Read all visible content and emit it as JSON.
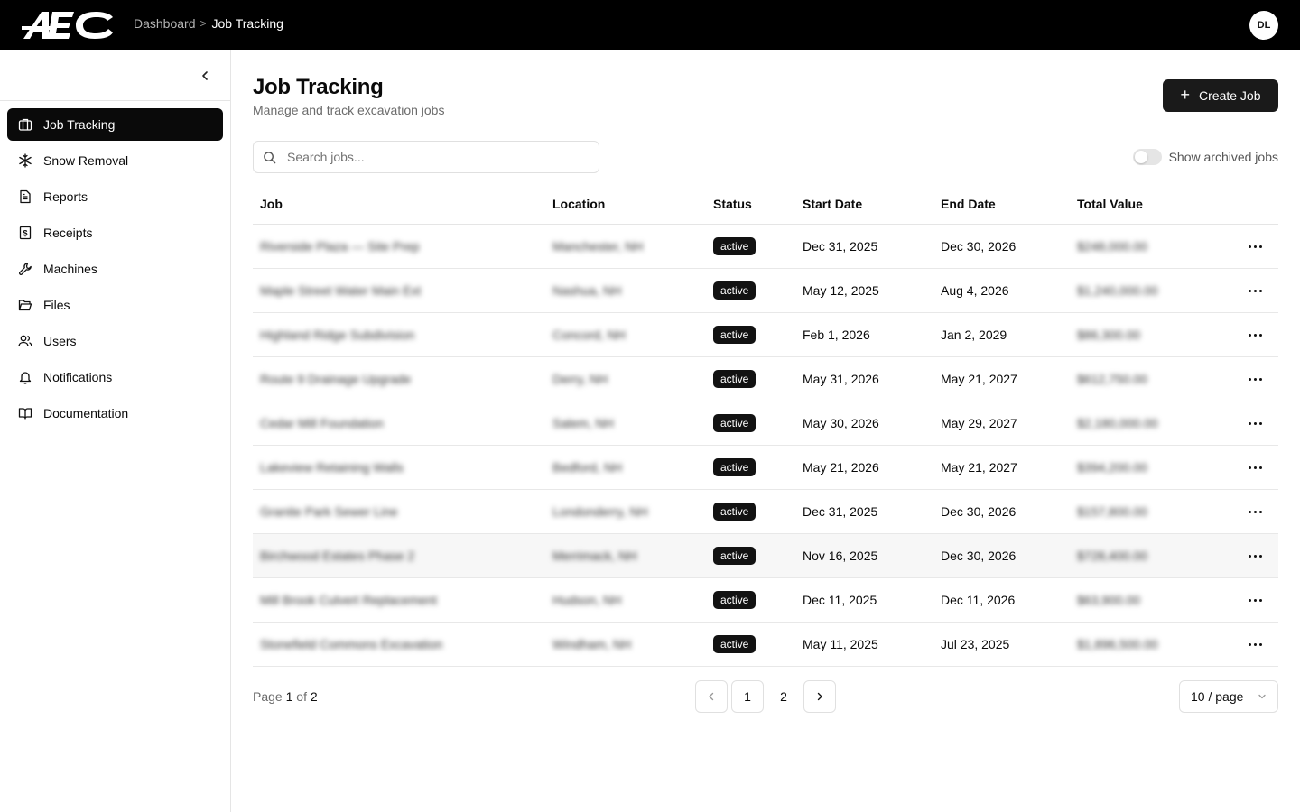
{
  "topbar": {
    "logo_text": "AEC",
    "breadcrumb": {
      "parent": "Dashboard",
      "separator": ">",
      "current": "Job Tracking"
    },
    "avatar_initials": "DL"
  },
  "sidebar": {
    "items": [
      {
        "label": "Job Tracking",
        "icon": "briefcase-icon",
        "active": true
      },
      {
        "label": "Snow Removal",
        "icon": "snowflake-icon",
        "active": false
      },
      {
        "label": "Reports",
        "icon": "document-icon",
        "active": false
      },
      {
        "label": "Receipts",
        "icon": "receipt-dollar-icon",
        "active": false
      },
      {
        "label": "Machines",
        "icon": "wrench-icon",
        "active": false
      },
      {
        "label": "Files",
        "icon": "folder-open-icon",
        "active": false
      },
      {
        "label": "Users",
        "icon": "users-icon",
        "active": false
      },
      {
        "label": "Notifications",
        "icon": "bell-icon",
        "active": false
      },
      {
        "label": "Documentation",
        "icon": "book-open-icon",
        "active": false
      }
    ]
  },
  "main": {
    "title": "Job Tracking",
    "subtitle": "Manage and track excavation jobs",
    "create_button": "Create Job",
    "search_placeholder": "Search jobs...",
    "archived_toggle_label": "Show archived jobs",
    "archived_toggle_on": false
  },
  "table": {
    "columns": [
      "Job",
      "Location",
      "Status",
      "Start Date",
      "End Date",
      "Total Value"
    ],
    "rows": [
      {
        "job": "Riverside Plaza — Site Prep",
        "location": "Manchester, NH",
        "status": "active",
        "start": "Dec 31, 2025",
        "end": "Dec 30, 2026",
        "value": "$248,000.00"
      },
      {
        "job": "Maple Street Water Main Ext",
        "location": "Nashua, NH",
        "status": "active",
        "start": "May 12, 2025",
        "end": "Aug 4, 2026",
        "value": "$1,240,000.00"
      },
      {
        "job": "Highland Ridge Subdivision",
        "location": "Concord, NH",
        "status": "active",
        "start": "Feb 1, 2026",
        "end": "Jan 2, 2029",
        "value": "$86,300.00"
      },
      {
        "job": "Route 9 Drainage Upgrade",
        "location": "Derry, NH",
        "status": "active",
        "start": "May 31, 2026",
        "end": "May 21, 2027",
        "value": "$612,750.00"
      },
      {
        "job": "Cedar Mill Foundation",
        "location": "Salem, NH",
        "status": "active",
        "start": "May 30, 2026",
        "end": "May 29, 2027",
        "value": "$2,180,000.00"
      },
      {
        "job": "Lakeview Retaining Walls",
        "location": "Bedford, NH",
        "status": "active",
        "start": "May 21, 2026",
        "end": "May 21, 2027",
        "value": "$394,200.00"
      },
      {
        "job": "Granite Park Sewer Line",
        "location": "Londonderry, NH",
        "status": "active",
        "start": "Dec 31, 2025",
        "end": "Dec 30, 2026",
        "value": "$157,800.00"
      },
      {
        "job": "Birchwood Estates Phase 2",
        "location": "Merrimack, NH",
        "status": "active",
        "start": "Nov 16, 2025",
        "end": "Dec 30, 2026",
        "value": "$728,400.00"
      },
      {
        "job": "Mill Brook Culvert Replacement",
        "location": "Hudson, NH",
        "status": "active",
        "start": "Dec 11, 2025",
        "end": "Dec 11, 2026",
        "value": "$63,900.00"
      },
      {
        "job": "Stonefield Commons Excavation",
        "location": "Windham, NH",
        "status": "active",
        "start": "May 11, 2025",
        "end": "Jul 23, 2025",
        "value": "$1,896,500.00"
      }
    ]
  },
  "pagination": {
    "label_page": "Page",
    "current": "1",
    "label_of": "of",
    "total": "2",
    "pages": [
      "1",
      "2"
    ],
    "per_page": "10 / page"
  },
  "colors": {
    "topbar": "#000000",
    "active_nav": "#0a0a0a",
    "primary_button": "#1a1a1a",
    "badge": "#121212",
    "border": "#e5e5e5"
  }
}
